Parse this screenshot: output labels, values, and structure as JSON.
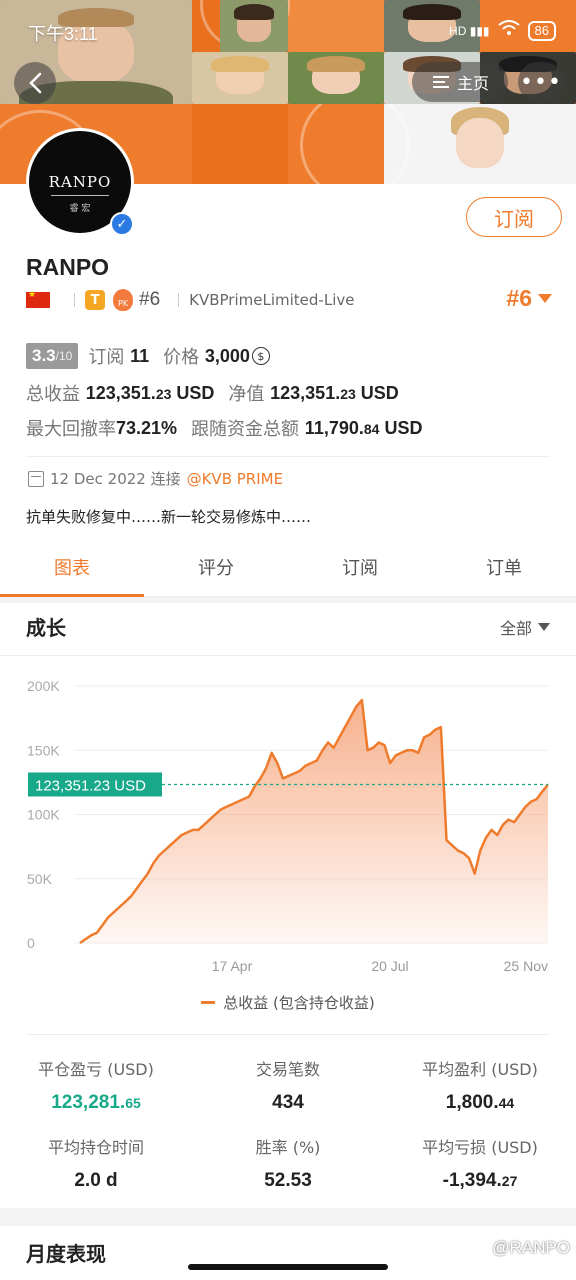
{
  "status": {
    "time": "下午3:11",
    "battery": "86",
    "signal_label": "HD"
  },
  "nav": {
    "home_label": "主页",
    "more_label": "•••"
  },
  "profile": {
    "avatar_text": "RANPO",
    "avatar_subtext": "睿 宏",
    "name": "RANPO",
    "subscribe_label": "订阅",
    "tier_badge": "T",
    "pk_badge": "PK",
    "rank_small": "#6",
    "broker": "KVBPrimeLimited-Live",
    "rank_big": "#6"
  },
  "stats": {
    "score": "3.3",
    "score_max": "/10",
    "subscribers_label": "订阅",
    "subscribers": "11",
    "price_label": "价格",
    "price": "3,000",
    "total_profit_label": "总收益",
    "total_profit_main": "123,351.",
    "total_profit_dec": "23",
    "total_profit_unit": " USD",
    "net_label": "净值",
    "net_main": "123,351.",
    "net_dec": "23",
    "net_unit": " USD",
    "drawdown_label": "最大回撤率",
    "drawdown": "73.21%",
    "follow_label": "跟随资金总额",
    "follow_main": "11,790.",
    "follow_dec": "84",
    "follow_unit": " USD"
  },
  "info": {
    "date": "12 Dec 2022 连接",
    "link": "@KVB PRIME",
    "motto": "抗单失败修复中……新一轮交易修炼中……"
  },
  "tabs": [
    "图表",
    "评分",
    "订阅",
    "订单"
  ],
  "chart_section": {
    "title": "成长",
    "filter": "全部"
  },
  "chart_data": {
    "type": "area",
    "title": "成长",
    "yticks": [
      "200K",
      "150K",
      "100K",
      "50K",
      "0"
    ],
    "ylim": [
      0,
      200000
    ],
    "xticks": [
      "17 Apr",
      "20 Jul",
      "25 Nov"
    ],
    "current_label": "123,351.23 USD",
    "current_value": 123351.23,
    "series": [
      {
        "name": "总收益 (包含持仓收益)",
        "values": [
          0,
          3000,
          6000,
          8000,
          14000,
          20000,
          24000,
          28000,
          32000,
          36000,
          42000,
          48000,
          54000,
          62000,
          68000,
          72000,
          76000,
          80000,
          84000,
          86000,
          88000,
          88000,
          92000,
          96000,
          100000,
          104000,
          106000,
          108000,
          110000,
          112000,
          114000,
          122000,
          128000,
          136000,
          148000,
          140000,
          128000,
          130000,
          132000,
          134000,
          138000,
          140000,
          142000,
          150000,
          156000,
          152000,
          160000,
          168000,
          176000,
          184000,
          189000,
          150000,
          152000,
          156000,
          154000,
          140000,
          146000,
          148000,
          150000,
          150000,
          148000,
          160000,
          162000,
          166000,
          168000,
          80000,
          76000,
          72000,
          70000,
          66000,
          54000,
          72000,
          82000,
          88000,
          84000,
          92000,
          96000,
          94000,
          100000,
          106000,
          110000,
          112000,
          118000,
          123351
        ]
      }
    ],
    "legend": "总收益 (包含持仓收益)",
    "colors": {
      "line": "#ef7b2c",
      "fill_top": "#f5a47a",
      "current": "#18a88a"
    }
  },
  "metrics": [
    {
      "label": "平仓盈亏 (USD)",
      "main": "123,281.",
      "dec": "65",
      "green": true
    },
    {
      "label": "交易笔数",
      "main": "434",
      "dec": "",
      "green": false
    },
    {
      "label": "平均盈利 (USD)",
      "main": "1,800.",
      "dec": "44",
      "green": false
    },
    {
      "label": "平均持仓时间",
      "main": "2.0 d",
      "dec": "",
      "green": false
    },
    {
      "label": "胜率 (%)",
      "main": "52.53",
      "dec": "",
      "green": false
    },
    {
      "label": "平均亏损 (USD)",
      "main": "-1,394.",
      "dec": "27",
      "green": false
    }
  ],
  "monthly_title": "月度表现",
  "watermark": "@RANPO",
  "icons": [
    "back-arrow-icon",
    "home-icon",
    "calendar-icon",
    "verified-icon",
    "coin-icon",
    "wifi-icon"
  ]
}
